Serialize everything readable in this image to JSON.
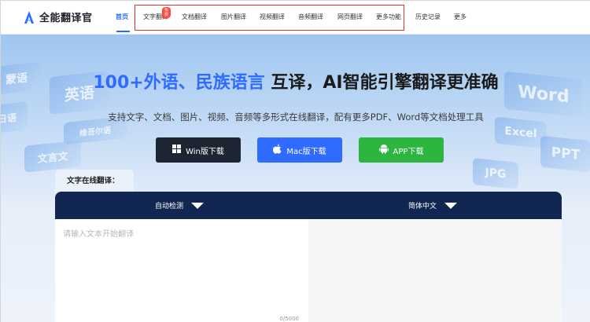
{
  "header": {
    "brand": "全能翻译官",
    "nav": [
      {
        "label": "首页",
        "active": true
      },
      {
        "label": "文字翻译",
        "badge": "免费"
      },
      {
        "label": "文档翻译"
      },
      {
        "label": "图片翻译"
      },
      {
        "label": "视频翻译"
      },
      {
        "label": "音频翻译"
      },
      {
        "label": "网页翻译"
      },
      {
        "label": "更多功能"
      },
      {
        "label": "历史记录"
      },
      {
        "label": "更多"
      }
    ]
  },
  "hero": {
    "headline_highlight": "100+外语、民族语言",
    "headline_rest": " 互译，AI智能引擎翻译更准确",
    "subline": "支持文字、文档、图片、视频、音频等多形式在线翻译，配有更多PDF、Word等文档处理工具",
    "decor_words": [
      "蒙语",
      "英语",
      "日语",
      "维吾尔语",
      "文言文",
      "Word",
      "Excel",
      "PPT",
      "JPG"
    ],
    "buttons": {
      "win": "Win版下载",
      "mac": "Mac版下载",
      "app": "APP下载"
    }
  },
  "translator": {
    "tab_label": "文字在线翻译：",
    "source_lang": "自动检测",
    "target_lang": "简体中文",
    "input_placeholder": "请输入文本开始翻译",
    "char_counter": "0/5000"
  },
  "colors": {
    "accent": "#2f6bff",
    "panel_header": "#112650",
    "win_button": "#1d2533",
    "app_button": "#2cb53f",
    "badge": "#ff4a3d",
    "highlight_box": "#e0312b"
  }
}
